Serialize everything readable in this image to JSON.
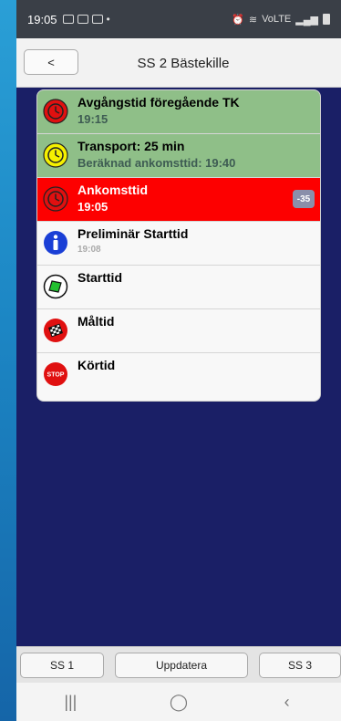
{
  "status": {
    "time": "19:05",
    "network": "VoLTE"
  },
  "header": {
    "back_label": "<",
    "title": "SS 2 Bästekille"
  },
  "rows": [
    {
      "main": "Avgångstid föregående TK",
      "sub": "19:15",
      "icon": "red-clock-icon",
      "style": "green"
    },
    {
      "main": "Transport: 25 min",
      "sub": "Beräknad ankomsttid: 19:40",
      "icon": "yellow-clock-icon",
      "style": "green"
    },
    {
      "main": "Ankomsttid",
      "sub": "19:05",
      "icon": "red-clock-icon",
      "style": "red",
      "badge": "-35"
    },
    {
      "main": "Preliminär Starttid",
      "sub": "19:08",
      "icon": "info-icon",
      "style": "plain"
    },
    {
      "main": "Starttid",
      "sub": "",
      "icon": "green-flag-icon",
      "style": "plain"
    },
    {
      "main": "Måltid",
      "sub": "",
      "icon": "checkered-flag-icon",
      "style": "plain"
    },
    {
      "main": "Körtid",
      "sub": "",
      "icon": "stop-sign-icon",
      "style": "plain"
    }
  ],
  "bottom": {
    "prev_label": "SS 1",
    "update_label": "Uppdatera",
    "next_label": "SS 3"
  },
  "colors": {
    "background": "#1a1f66",
    "green_row": "#8fbf88",
    "red_row": "#fd0000",
    "badge": "#8a8faa"
  }
}
